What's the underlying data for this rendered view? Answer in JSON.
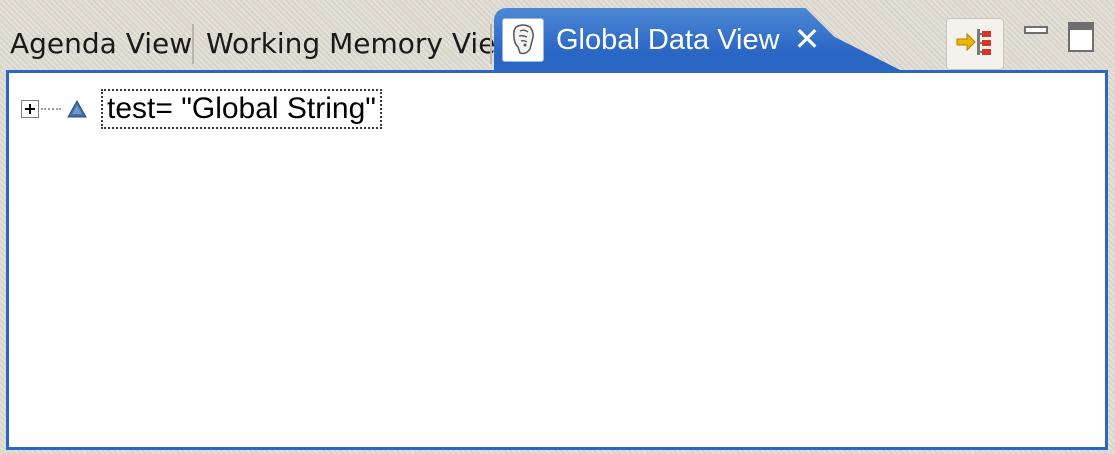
{
  "tabs": {
    "agenda_label": "Agenda View",
    "working_memory_label": "Working Memory View",
    "global_data_label": "Global Data View",
    "close_glyph": "✕"
  },
  "tree": {
    "items": [
      {
        "label": "test= \"Global String\"",
        "expanded": false
      }
    ]
  },
  "colors": {
    "active_tab": "#2a66c4",
    "border": "#2a66c4",
    "node_icon": "#3f6fa8"
  },
  "icons": {
    "tab_icon": "drools-head-icon",
    "action": "show-logical-structure-icon",
    "minimize": "minimize-icon",
    "maximize": "maximize-icon",
    "node": "triangle-variable-icon",
    "expander": "plus-expander-icon"
  }
}
